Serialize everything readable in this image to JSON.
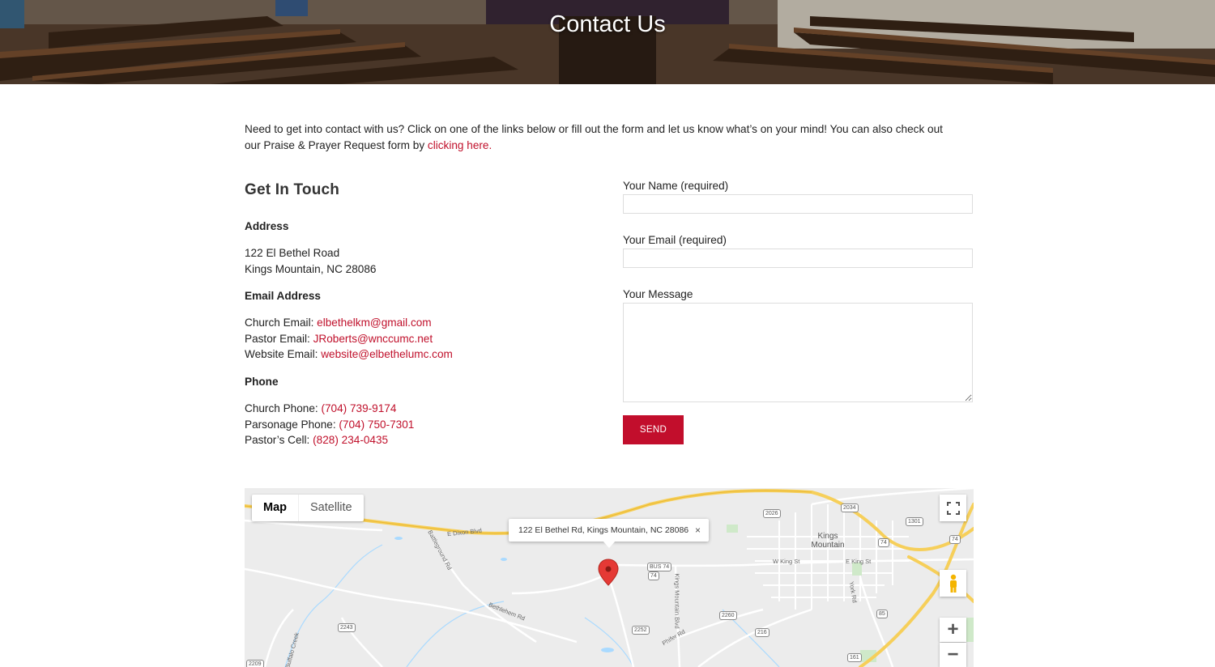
{
  "hero": {
    "title": "Contact Us"
  },
  "intro": {
    "text": "Need to get into contact with us?  Click on one of the links below or fill out the form and let us know what’s on your mind!  You can also check out our Praise & Prayer Request form by ",
    "link": "clicking here."
  },
  "contact": {
    "heading": "Get In Touch",
    "address_heading": "Address",
    "address_line1": "122 El Bethel Road",
    "address_line2": "Kings Mountain, NC 28086",
    "email_heading": "Email Address",
    "emails": [
      {
        "label": "Church Email: ",
        "value": "elbethelkm@gmail.com"
      },
      {
        "label": "Pastor Email: ",
        "value": "JRoberts@wnccumc.net"
      },
      {
        "label": "Website Email: ",
        "value": "website@elbethelumc.com"
      }
    ],
    "phone_heading": "Phone",
    "phones": [
      {
        "label": "Church Phone: ",
        "value": "(704) 739-9174"
      },
      {
        "label": "Parsonage Phone: ",
        "value": "(704) 750-7301"
      },
      {
        "label": "Pastor’s Cell: ",
        "value": "(828) 234-0435"
      }
    ]
  },
  "form": {
    "name_label": "Your Name (required)",
    "name_value": "",
    "email_label": "Your Email (required)",
    "email_value": "",
    "message_label": "Your Message",
    "message_value": "",
    "send_label": "SEND"
  },
  "map": {
    "type_map": "Map",
    "type_satellite": "Satellite",
    "info_text": "122 El Bethel Rd, Kings Mountain, NC 28086",
    "close": "×",
    "city": "Kings Mountain",
    "roads": {
      "dixon": "E Dixon Blvd",
      "battleground": "Battleground Rd",
      "bethlehem": "Bethlehem Rd",
      "kings_mtn_blvd": "Kings Mountain Blvd",
      "phifer": "Phifer Rd",
      "w_king": "W King St",
      "e_king": "E King St",
      "york": "York Rd",
      "buffalo": "Buffalo Creek"
    },
    "shields": [
      "2026",
      "2034",
      "1301",
      "74",
      "74",
      "BUS 74",
      "74",
      "2260",
      "216",
      "2252",
      "2243",
      "85",
      "161",
      "2209"
    ],
    "zoom_in": "+",
    "zoom_out": "−",
    "colors": {
      "highway": "#f6cf5a",
      "pin": "#e53935",
      "water": "#aadaff"
    }
  },
  "theme": {
    "accent": "#c20e2c"
  }
}
